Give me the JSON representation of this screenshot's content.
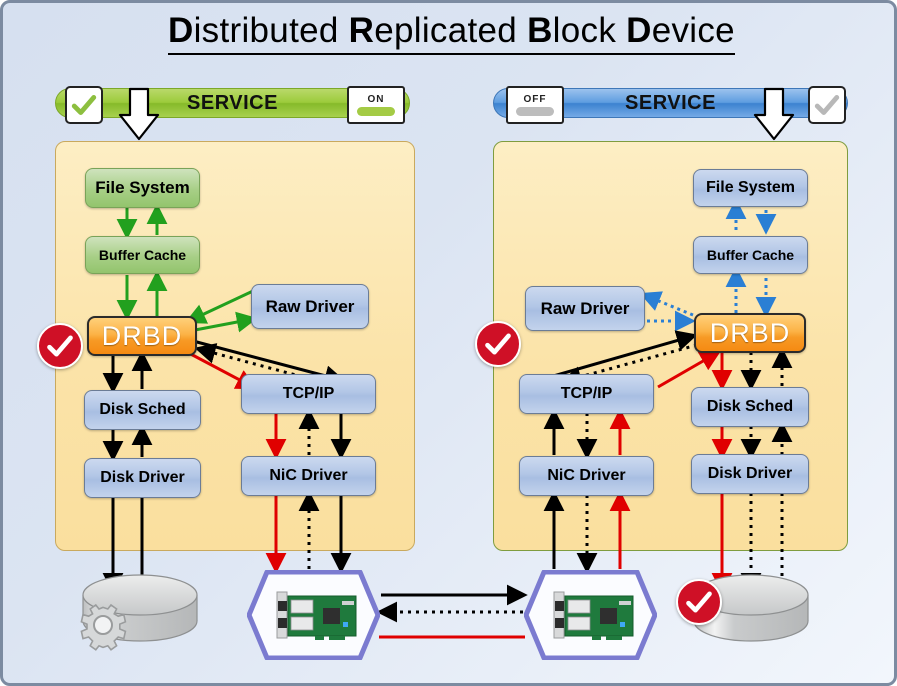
{
  "title": {
    "parts": [
      {
        "cap": "D",
        "rest": "istributed"
      },
      {
        "cap": "R",
        "rest": "eplicated"
      },
      {
        "cap": "B",
        "rest": "lock"
      },
      {
        "cap": "D",
        "rest": "evice"
      }
    ],
    "full_text": "Distributed Replicated Block Device"
  },
  "colors": {
    "service_on": "#9ccb3b",
    "service_off": "#5e9de0",
    "panel_bg": "#fbe3a8",
    "drbd": "#f79a25",
    "node_blue": "#b2c6e6",
    "node_green": "#a7cf86",
    "red_check": "#cf1026",
    "red_link": "#e00000",
    "green_link": "#22a01e",
    "blue_link": "#2a7fd4",
    "nic_border": "#7b7bd0",
    "background": "#dbe4f2"
  },
  "left_node": {
    "service": {
      "label": "SERVICE",
      "state": "on",
      "toggle_label": "ON",
      "check": "check-icon",
      "check_state": "active"
    },
    "drbd": {
      "label": "DRBD",
      "status": "primary"
    },
    "boxes": [
      {
        "id": "file-system",
        "label": "File System",
        "style": "green"
      },
      {
        "id": "buffer-cache",
        "label": "Buffer Cache",
        "style": "green"
      },
      {
        "id": "raw-driver",
        "label": "Raw Driver",
        "style": "blue"
      },
      {
        "id": "disk-sched",
        "label": "Disk Sched",
        "style": "blue"
      },
      {
        "id": "disk-driver",
        "label": "Disk Driver",
        "style": "blue"
      },
      {
        "id": "tcp-ip",
        "label": "TCP/IP",
        "style": "blue"
      },
      {
        "id": "nic-driver",
        "label": "NiC Driver",
        "style": "blue"
      }
    ],
    "storage": {
      "label": "disk-cylinder",
      "gear": "gear-icon"
    },
    "nic": {
      "label": "network-interface-card"
    }
  },
  "right_node": {
    "service": {
      "label": "SERVICE",
      "state": "off",
      "toggle_label": "OFF",
      "check": "check-icon",
      "check_state": "inactive"
    },
    "drbd": {
      "label": "DRBD",
      "status": "secondary"
    },
    "boxes": [
      {
        "id": "file-system",
        "label": "File System",
        "style": "blue"
      },
      {
        "id": "buffer-cache",
        "label": "Buffer Cache",
        "style": "blue"
      },
      {
        "id": "raw-driver",
        "label": "Raw Driver",
        "style": "blue"
      },
      {
        "id": "disk-sched",
        "label": "Disk Sched",
        "style": "blue"
      },
      {
        "id": "disk-driver",
        "label": "Disk Driver",
        "style": "blue"
      },
      {
        "id": "tcp-ip",
        "label": "TCP/IP",
        "style": "blue"
      },
      {
        "id": "nic-driver",
        "label": "NiC Driver",
        "style": "blue"
      }
    ],
    "storage": {
      "label": "disk-cylinder",
      "check": "red-check-icon"
    },
    "nic": {
      "label": "network-interface-card"
    }
  },
  "links": {
    "network": [
      {
        "style": "solid-black",
        "direction": "left-to-right"
      },
      {
        "style": "dotted-black",
        "direction": "right-to-left"
      },
      {
        "style": "solid-red",
        "direction": "none"
      }
    ]
  }
}
